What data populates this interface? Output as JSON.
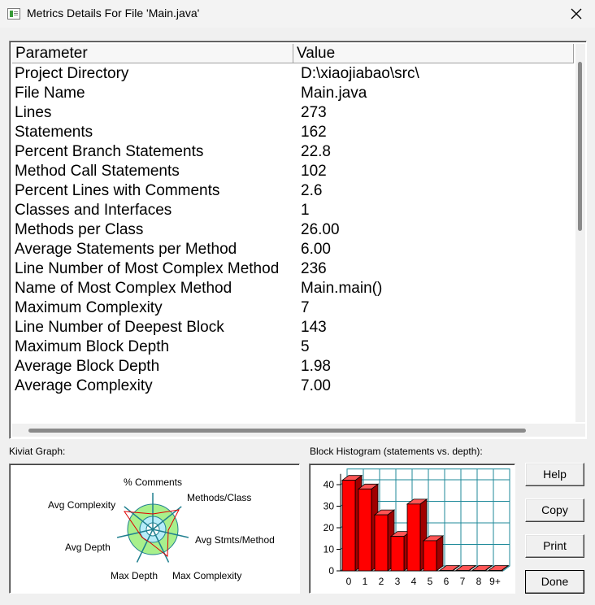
{
  "window": {
    "title": "Metrics Details For File 'Main.java'"
  },
  "table": {
    "headers": {
      "parameter": "Parameter",
      "value": "Value"
    },
    "rows": [
      {
        "parameter": "Project Directory",
        "value": "D:\\xiaojiabao\\src\\"
      },
      {
        "parameter": "File Name",
        "value": "Main.java"
      },
      {
        "parameter": "Lines",
        "value": "273"
      },
      {
        "parameter": "Statements",
        "value": "162"
      },
      {
        "parameter": "Percent Branch Statements",
        "value": "22.8"
      },
      {
        "parameter": "Method Call Statements",
        "value": "102"
      },
      {
        "parameter": "Percent Lines with Comments",
        "value": "2.6"
      },
      {
        "parameter": "Classes and Interfaces",
        "value": "1"
      },
      {
        "parameter": "Methods per Class",
        "value": "26.00"
      },
      {
        "parameter": "Average Statements per Method",
        "value": "6.00"
      },
      {
        "parameter": "Line Number of Most Complex Method",
        "value": "236"
      },
      {
        "parameter": "Name of Most Complex Method",
        "value": "Main.main()"
      },
      {
        "parameter": "Maximum Complexity",
        "value": "7"
      },
      {
        "parameter": "Line Number of Deepest Block",
        "value": "143"
      },
      {
        "parameter": "Maximum Block Depth",
        "value": "5"
      },
      {
        "parameter": "Average Block Depth",
        "value": "1.98"
      },
      {
        "parameter": "Average Complexity",
        "value": "7.00"
      }
    ]
  },
  "kiviat": {
    "label": "Kiviat Graph:",
    "axes": {
      "comments": "% Comments",
      "methods_class": "Methods/Class",
      "avg_stmts": "Avg Stmts/Method",
      "max_complexity": "Max Complexity",
      "max_depth": "Max Depth",
      "avg_depth": "Avg Depth",
      "avg_complexity": "Avg Complexity"
    },
    "colors": {
      "outer_ring": "#a8f08c",
      "inner_ring": "#b6ecf8",
      "axis": "#1f7f8f",
      "polygon": "#e00000"
    }
  },
  "histogram": {
    "label": "Block Histogram (statements vs. depth):",
    "colors": {
      "bar": "#ff0000",
      "grid": "#1f8a9a"
    }
  },
  "chart_data": {
    "type": "bar",
    "title": "Block Histogram (statements vs. depth):",
    "categories": [
      "0",
      "1",
      "2",
      "3",
      "4",
      "5",
      "6",
      "7",
      "8",
      "9+"
    ],
    "values": [
      42,
      38,
      26,
      16,
      31,
      14,
      0,
      0,
      0,
      0
    ],
    "yticks": [
      "0",
      "10",
      "20",
      "30",
      "40"
    ],
    "ylim": [
      0,
      45
    ],
    "grid": true
  },
  "buttons": {
    "help": "Help",
    "copy": "Copy",
    "print": "Print",
    "done": "Done"
  }
}
